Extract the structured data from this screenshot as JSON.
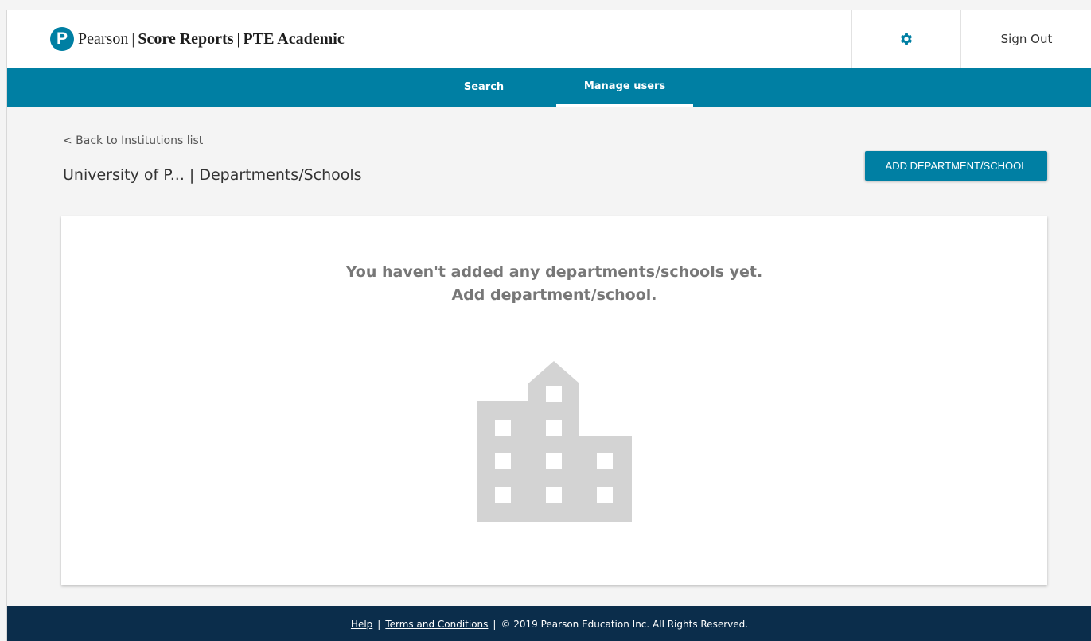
{
  "header": {
    "logo_letter": "P",
    "brand_name": "Pearson",
    "product": "Score Reports",
    "subproduct": "PTE Academic",
    "separator": "|",
    "settings_icon": "gear-icon",
    "sign_out_label": "Sign Out"
  },
  "nav": {
    "tabs": [
      {
        "label": "Search"
      },
      {
        "label": "Manage users",
        "active": true
      }
    ]
  },
  "content": {
    "back_link": "< Back to Institutions list",
    "page_title": "University of P... | Departments/Schools",
    "add_button_label": "ADD DEPARTMENT/SCHOOL",
    "empty_line1": "You haven't added any departments/schools yet.",
    "empty_line2": "Add department/school.",
    "empty_icon": "building-icon"
  },
  "footer": {
    "help": "Help",
    "terms": "Terms and Conditions",
    "separator": "|",
    "copyright": "© 2019 Pearson Education Inc. All Rights Reserved."
  },
  "colors": {
    "accent": "#007fa3",
    "footer_bg": "#0b2d4b",
    "page_bg": "#f4f4f4",
    "placeholder_gray": "#d3d3d3"
  }
}
